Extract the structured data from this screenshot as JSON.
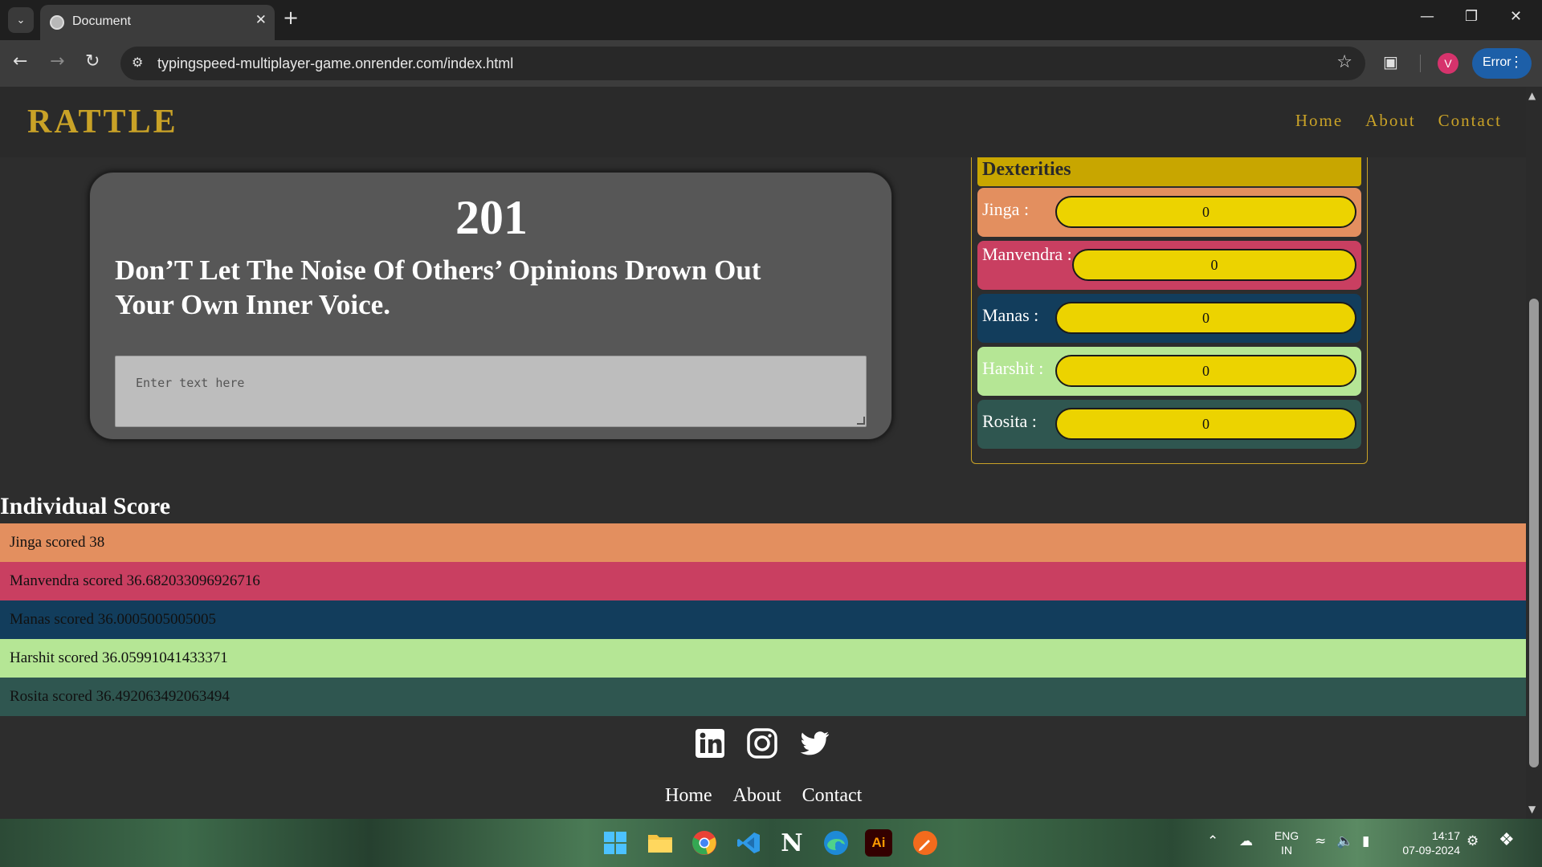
{
  "browser": {
    "tab_title": "Document",
    "url": "typingspeed-multiplayer-game.onrender.com/index.html",
    "profile_initial": "V",
    "error_label": "Error"
  },
  "site": {
    "logo": "RATTLE",
    "nav": [
      "Home",
      "About",
      "Contact"
    ]
  },
  "game": {
    "countdown": "201",
    "quote_line1": "Don’T Let The Noise Of Others’ Opinions Drown Out",
    "quote_line2": "Your Own Inner Voice.",
    "input_placeholder": "Enter text here"
  },
  "dexterities": {
    "title": "Dexterities",
    "players": [
      {
        "name": "Jinga :",
        "value": "0",
        "bg": "#e38f5f",
        "fg": "#ffffff"
      },
      {
        "name": "Manvendra :",
        "value": "0",
        "bg": "#c93f61",
        "fg": "#ffffff"
      },
      {
        "name": "Manas :",
        "value": "0",
        "bg": "#123d5c",
        "fg": "#ffffff"
      },
      {
        "name": "Harshit :",
        "value": "0",
        "bg": "#b5e695",
        "fg": "#ffffff"
      },
      {
        "name": "Rosita :",
        "value": "0",
        "bg": "#2f5650",
        "fg": "#ffffff"
      }
    ]
  },
  "scores": {
    "title": "Individual Score",
    "rows": [
      {
        "text": "Jinga scored 38",
        "bg": "#e38f5f"
      },
      {
        "text": "Manvendra scored 36.682033096926716",
        "bg": "#c93f61"
      },
      {
        "text": "Manas scored 36.0005005005005",
        "bg": "#123d5c"
      },
      {
        "text": "Harshit scored 36.05991041433371",
        "bg": "#b5e695"
      },
      {
        "text": "Rosita scored 36.492063492063494",
        "bg": "#2f5650"
      }
    ]
  },
  "footer": {
    "social": [
      "linkedin-icon",
      "instagram-icon",
      "twitter-icon"
    ],
    "nav": [
      "Home",
      "About",
      "Contact"
    ]
  },
  "taskbar": {
    "lang_line1": "ENG",
    "lang_line2": "IN",
    "time": "14:17",
    "date": "07-09-2024",
    "apps": [
      "windows-start",
      "file-explorer",
      "chrome",
      "vscode",
      "notion",
      "edge",
      "illustrator",
      "pen-tool-app"
    ]
  }
}
